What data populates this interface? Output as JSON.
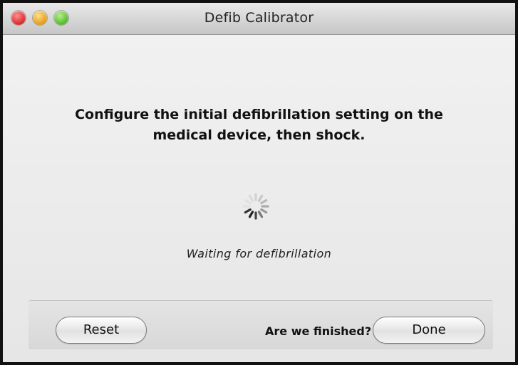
{
  "window": {
    "title": "Defib Calibrator"
  },
  "main": {
    "instruction_line1": "Configure the initial defibrillation setting on the",
    "instruction_line2": "medical device, then shock.",
    "status": "Waiting for defibrillation",
    "spinner_icon": "loading-spinner-icon"
  },
  "footer": {
    "reset_label": "Reset",
    "finished_prompt": "Are we finished?",
    "done_label": "Done"
  },
  "colors": {
    "close": "#d8262a",
    "minimize": "#e39b14",
    "zoom": "#52b82c"
  }
}
